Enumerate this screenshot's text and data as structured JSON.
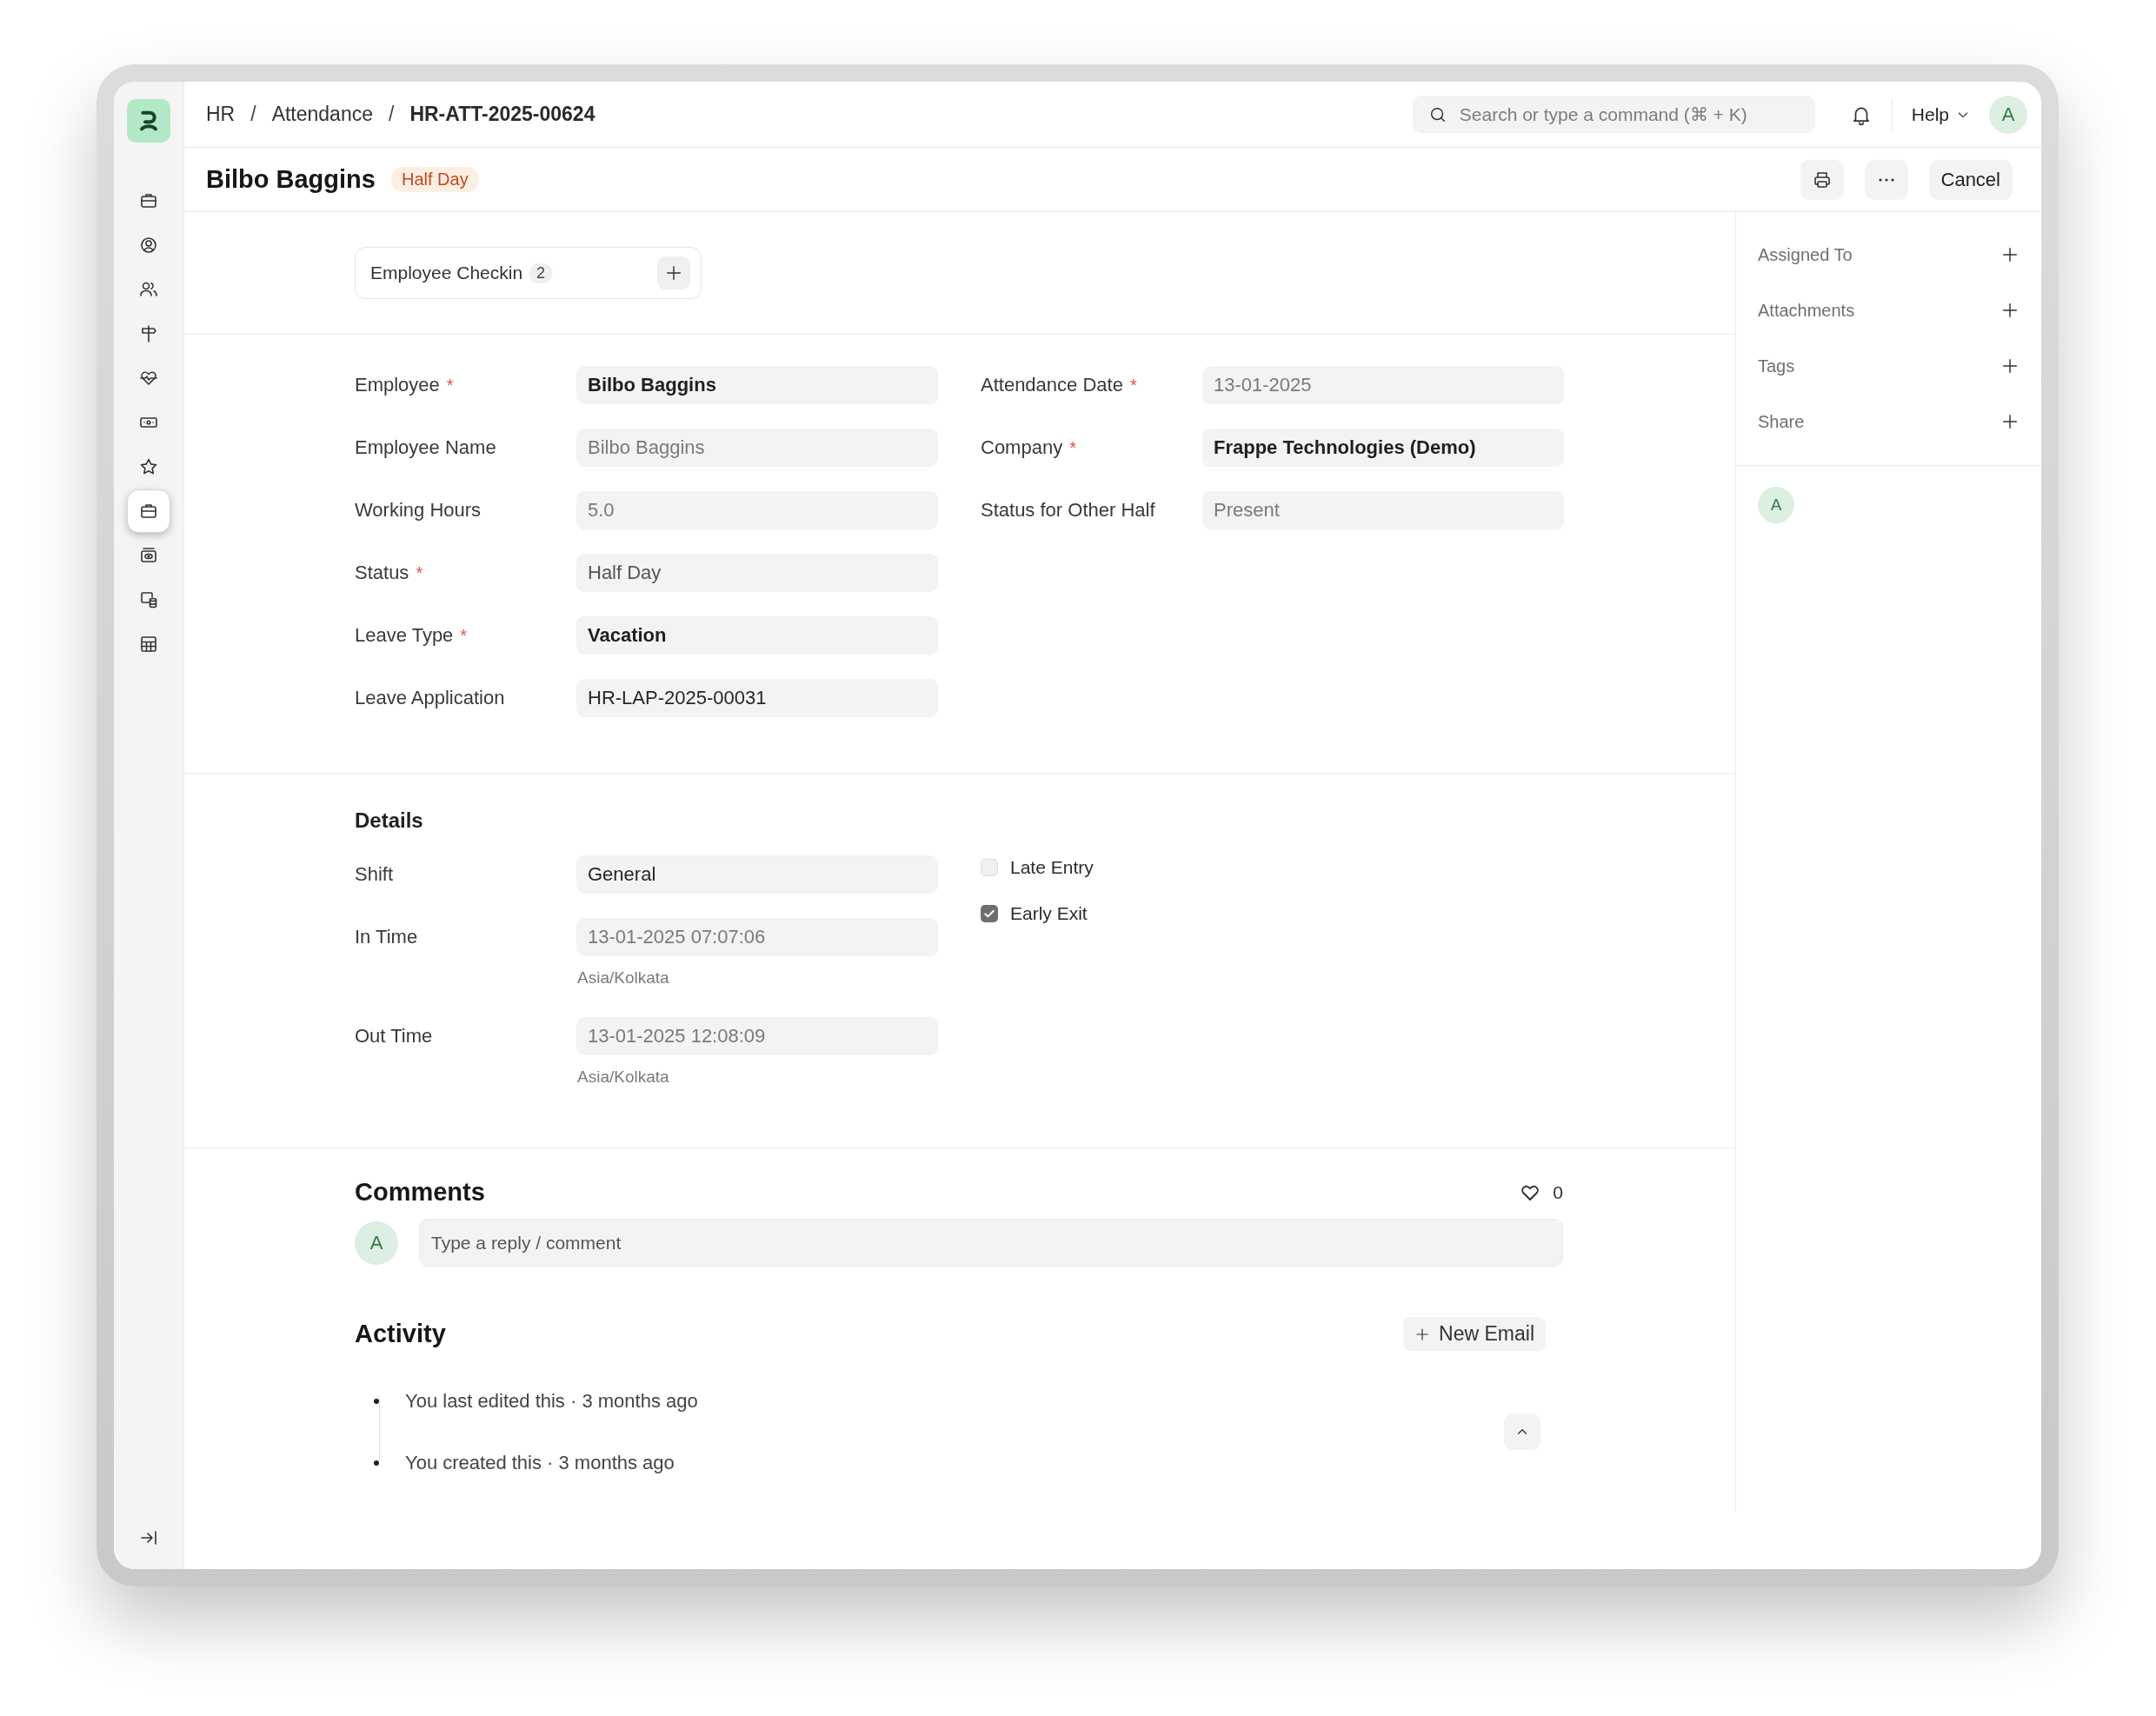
{
  "sidebar": {
    "items": [
      {
        "selected": false
      },
      {
        "selected": false
      },
      {
        "selected": false
      },
      {
        "selected": false
      },
      {
        "selected": false
      },
      {
        "selected": false
      },
      {
        "selected": false
      },
      {
        "selected": true
      },
      {
        "selected": false
      },
      {
        "selected": false
      },
      {
        "selected": false
      }
    ]
  },
  "breadcrumbs": [
    {
      "kind": "link",
      "label": "HR"
    },
    {
      "kind": "separator",
      "label": "/"
    },
    {
      "kind": "link",
      "label": "Attendance"
    },
    {
      "kind": "separator",
      "label": "/"
    },
    {
      "kind": "current",
      "label": "HR-ATT-2025-00624"
    }
  ],
  "search": {
    "placeholder": "Search or type a command (⌘ + K)"
  },
  "help_menu": {
    "label": "Help"
  },
  "user_avatar": {
    "initial": "A"
  },
  "page_title": "Bilbo Baggins",
  "status_badge": {
    "label": "Half Day"
  },
  "actions": {
    "cancel": "Cancel"
  },
  "connections": [
    {
      "label": "Employee Checkin",
      "count": "2"
    }
  ],
  "sections": [
    {
      "columns": [
        [
          {
            "kind": "link",
            "label": "Employee",
            "required_mark": "*",
            "value": "Bilbo Baggins"
          },
          {
            "kind": "read_only",
            "label": "Employee Name",
            "value": "Bilbo Baggins"
          },
          {
            "kind": "read_only",
            "label": "Working Hours",
            "value": "5.0"
          },
          {
            "kind": "select",
            "label": "Status",
            "required_mark": "*",
            "value": "Half Day"
          },
          {
            "kind": "link",
            "label": "Leave Type",
            "required_mark": "*",
            "value": "Vacation"
          },
          {
            "kind": "data",
            "label": "Leave Application",
            "value": "HR-LAP-2025-00031"
          }
        ],
        [
          {
            "kind": "read_only",
            "label": "Attendance Date",
            "required_mark": "*",
            "value": "13-01-2025"
          },
          {
            "kind": "link",
            "label": "Company",
            "required_mark": "*",
            "value": "Frappe Technologies (Demo)"
          },
          {
            "kind": "read_only",
            "label": "Status for Other Half",
            "value": "Present"
          }
        ]
      ]
    },
    {
      "title": "Details",
      "columns": [
        [
          {
            "kind": "data",
            "label": "Shift",
            "value": "General"
          },
          {
            "kind": "read_only",
            "label": "In Time",
            "value": "13-01-2025 07:07:06",
            "hint": "Asia/Kolkata"
          },
          {
            "kind": "read_only",
            "label": "Out Time",
            "value": "13-01-2025 12:08:09",
            "hint": "Asia/Kolkata"
          }
        ],
        [
          {
            "kind": "checkbox",
            "label": "Late Entry",
            "checked": false
          },
          {
            "kind": "checkbox",
            "label": "Early Exit",
            "checked": true
          }
        ]
      ]
    }
  ],
  "comments": {
    "title": "Comments",
    "likes": "0",
    "avatar": "A",
    "placeholder": "Type a reply / comment"
  },
  "activity": {
    "title": "Activity",
    "new_email": "New Email",
    "items": [
      "You last edited this · 3 months ago",
      "You created this · 3 months ago"
    ]
  },
  "side_panel": {
    "items": [
      {
        "label": "Assigned To"
      },
      {
        "label": "Attachments"
      },
      {
        "label": "Tags"
      },
      {
        "label": "Share"
      }
    ],
    "viewers": [
      {
        "initial": "A"
      }
    ]
  }
}
